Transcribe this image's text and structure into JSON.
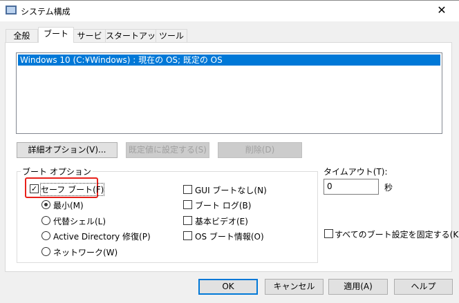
{
  "window": {
    "title": "システム構成",
    "close": "✕"
  },
  "tabs": [
    {
      "label": "全般"
    },
    {
      "label": "ブート"
    },
    {
      "label": "サービス"
    },
    {
      "label": "スタートアップ"
    },
    {
      "label": "ツール"
    }
  ],
  "boot_list": {
    "items": [
      "Windows 10 (C:¥Windows) : 現在の OS; 既定の OS"
    ]
  },
  "buttons": {
    "advanced": "詳細オプション(V)...",
    "set_default": "既定値に設定する(S)",
    "delete": "削除(D)",
    "ok": "OK",
    "cancel": "キャンセル",
    "apply": "適用(A)",
    "help": "ヘルプ"
  },
  "boot_options": {
    "label": "ブート オプション",
    "safe_boot": "セーフ ブート(F)",
    "safe_boot_checked": true,
    "radios": [
      {
        "label": "最小(M)",
        "selected": true
      },
      {
        "label": "代替シェル(L)",
        "selected": false
      },
      {
        "label": "Active Directory 修復(P)",
        "selected": false
      },
      {
        "label": "ネットワーク(W)",
        "selected": false
      }
    ],
    "checks": [
      {
        "label": "GUI ブートなし(N)",
        "checked": false
      },
      {
        "label": "ブート ログ(B)",
        "checked": false
      },
      {
        "label": "基本ビデオ(E)",
        "checked": false
      },
      {
        "label": "OS ブート情報(O)",
        "checked": false
      }
    ]
  },
  "timeout": {
    "label": "タイムアウト(T):",
    "value": "0",
    "unit": "秒"
  },
  "lock": {
    "label": "すべてのブート設定を固定する(K)",
    "checked": false
  }
}
